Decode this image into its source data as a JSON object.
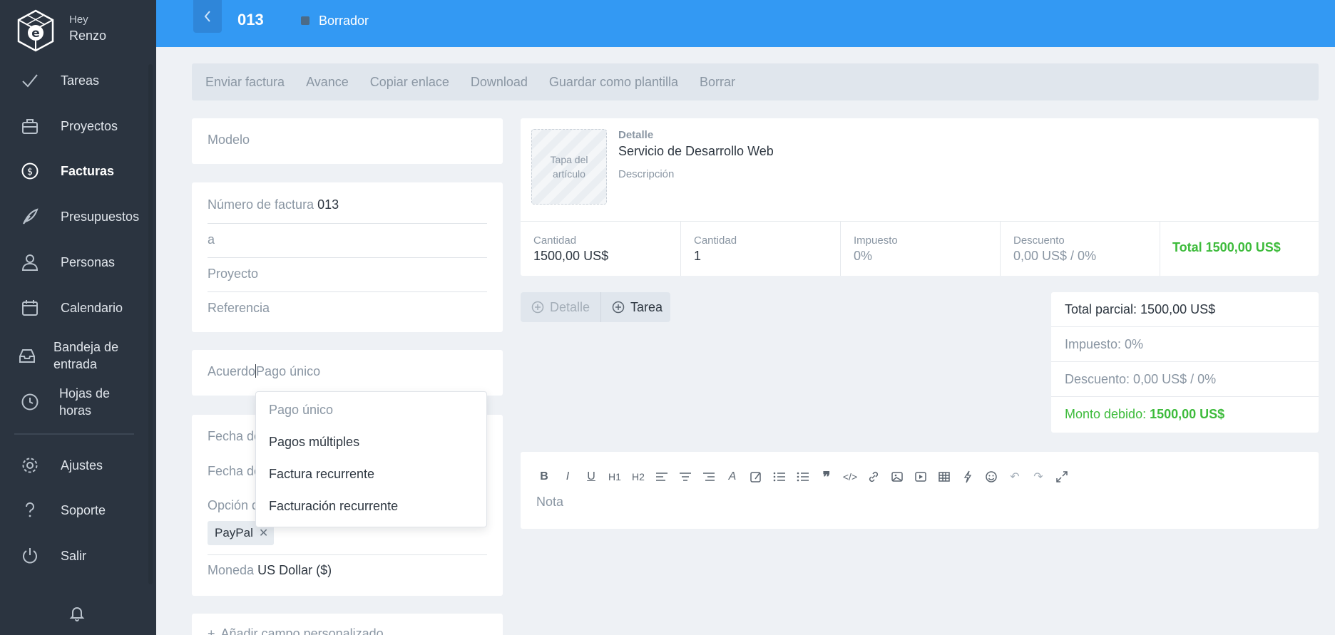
{
  "sidebar": {
    "greeting": "Hey",
    "user_name": "Renzo",
    "items": [
      {
        "label": "Tareas",
        "icon": "check-icon"
      },
      {
        "label": "Proyectos",
        "icon": "briefcase-icon"
      },
      {
        "label": "Facturas",
        "icon": "dollar-circle-icon"
      },
      {
        "label": "Presupuestos",
        "icon": "quill-icon"
      },
      {
        "label": "Personas",
        "icon": "user-icon"
      },
      {
        "label": "Calendario",
        "icon": "calendar-icon"
      },
      {
        "label_line1": "Bandeja de",
        "label_line2": "entrada",
        "icon": "inbox-icon"
      },
      {
        "label_line1": "Hojas de",
        "label_line2": "horas",
        "icon": "clock-icon"
      },
      {
        "label": "Ajustes",
        "icon": "gear-icon"
      },
      {
        "label": "Soporte",
        "icon": "question-icon"
      },
      {
        "label": "Salir",
        "icon": "power-icon"
      }
    ]
  },
  "header": {
    "invoice_number": "013",
    "status": "Borrador"
  },
  "actions": [
    "Enviar factura",
    "Avance",
    "Copiar enlace",
    "Download",
    "Guardar como plantilla",
    "Borrar"
  ],
  "form": {
    "model_placeholder": "Modelo",
    "invoice_number_label": "Número de factura",
    "invoice_number_value": "013",
    "to_placeholder": "a",
    "project_placeholder": "Proyecto",
    "reference_placeholder": "Referencia",
    "agreement_label": "Acuerdo",
    "agreement_value": "Pago único",
    "date1_label": "Fecha de",
    "date2_label": "Fecha de",
    "payment_option_label": "Opción d",
    "payment_tag": "PayPal",
    "currency_label": "Moneda",
    "currency_value": "US Dollar ($)",
    "add_custom_field": "Añadir campo personalizado"
  },
  "dropdown": {
    "options": [
      "Pago único",
      "Pagos múltiples",
      "Factura recurrente",
      "Facturación recurrente"
    ]
  },
  "item": {
    "thumb_label_1": "Tapa del",
    "thumb_label_2": "artículo",
    "detail_label": "Detalle",
    "title": "Servicio de Desarrollo Web",
    "description_placeholder": "Descripción",
    "cells": [
      {
        "key": "Cantidad",
        "value": "1500,00 US$"
      },
      {
        "key": "Cantidad",
        "value": "1"
      },
      {
        "key": "Impuesto",
        "value": "0%"
      },
      {
        "key": "Descuento",
        "value": "0,00 US$ / 0%"
      }
    ],
    "total": "Total 1500,00 US$"
  },
  "add_buttons": {
    "detail": "Detalle",
    "task": "Tarea"
  },
  "totals": {
    "subtotal": "Total parcial: 1500,00 US$",
    "tax": "Impuesto: 0%",
    "discount": "Descuento: 0,00 US$ / 0%",
    "due_label": "Monto debido:",
    "due_value": "1500,00 US$"
  },
  "note": {
    "placeholder": "Nota"
  },
  "colors": {
    "accent": "#3399f3",
    "sidebar": "#2b3440",
    "success": "#3dbb3b"
  }
}
